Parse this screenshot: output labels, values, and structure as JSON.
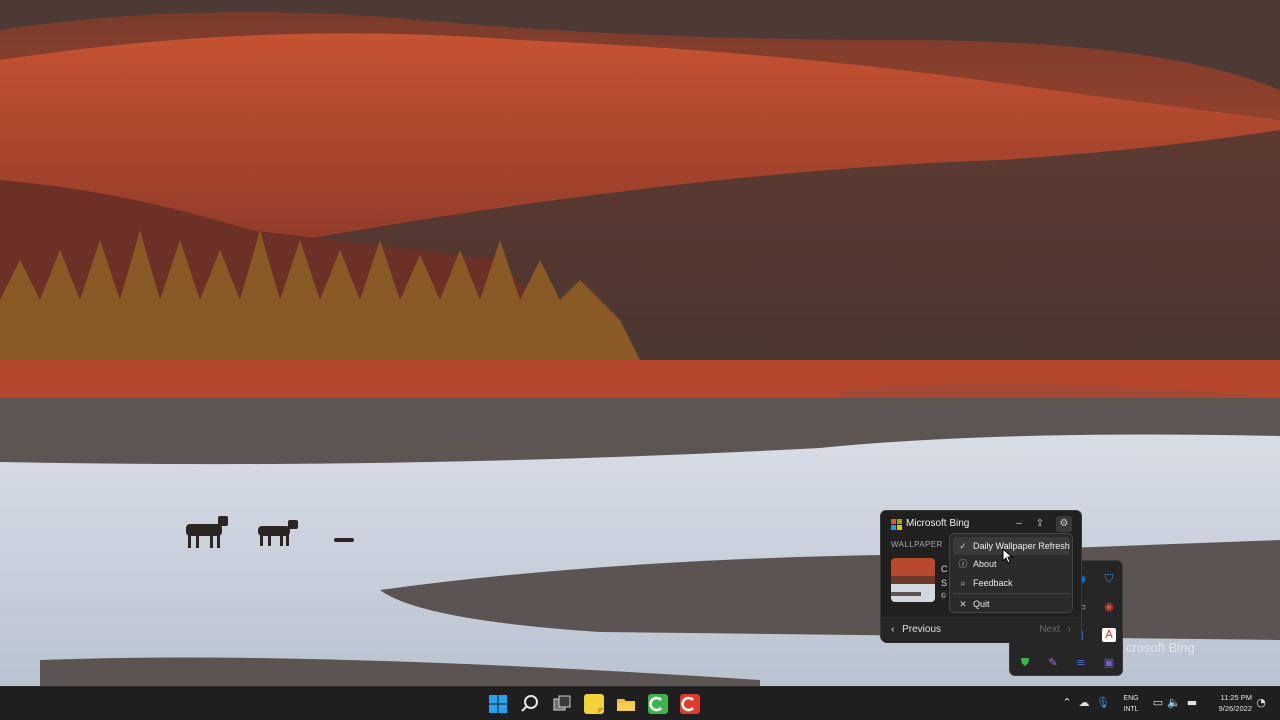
{
  "desktop": {
    "watermark": "crosoft Bing"
  },
  "flyout": {
    "title": "Microsoft Bing",
    "section_label": "WALLPAPER",
    "caption_line1": "C",
    "caption_line2": "S",
    "caption_line3": "©",
    "prev_label": "Previous",
    "next_label": "Next",
    "minimize_icon": "minimize-icon",
    "share_icon": "share-icon",
    "settings_icon": "gear-icon"
  },
  "menu": {
    "items": [
      {
        "label": "Daily Wallpaper Refresh",
        "icon": "checkmark-icon",
        "checked": true,
        "hovered": true
      },
      {
        "label": "About",
        "icon": "info-icon"
      },
      {
        "label": "Feedback",
        "icon": "feedback-icon"
      },
      {
        "label": "Quit",
        "icon": "close-icon"
      }
    ]
  },
  "tray_overflow": {
    "icons": [
      "defender-icon",
      "chrome-icon",
      "adobe-icon",
      "shield-icon",
      "pen-icon",
      "phone-link-icon",
      "teams-icon",
      "bing-icon",
      "onedrive-icon"
    ]
  },
  "taskbar": {
    "apps": [
      "start-icon",
      "search-icon",
      "task-view-icon",
      "sticky-notes-icon",
      "file-explorer-icon",
      "camtasia-green-icon",
      "camtasia-red-icon"
    ],
    "lang_line1": "ENG",
    "lang_line2": "INTL",
    "time": "11:25 PM",
    "date": "9/26/2022"
  },
  "colors": {
    "taskbar_bg": "#1f1f1f",
    "flyout_bg": "#202020",
    "menu_bg": "#2b2b2b",
    "accent": "#0078d4"
  }
}
